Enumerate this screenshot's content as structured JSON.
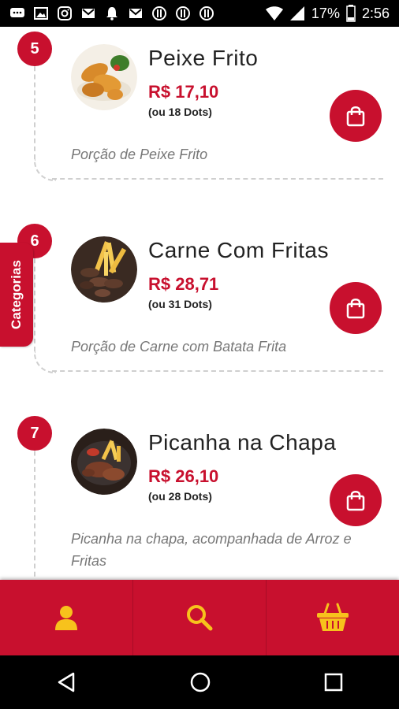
{
  "status_bar": {
    "battery": "17%",
    "time": "2:56"
  },
  "side_tab": {
    "label": "Categorias"
  },
  "products": [
    {
      "number": "5",
      "name": "Peixe Frito",
      "price": "R$ 17,10",
      "dots": "(ou 18 Dots)",
      "description": "Porção de Peixe Frito"
    },
    {
      "number": "6",
      "name": "Carne Com Fritas",
      "price": "R$ 28,71",
      "dots": "(ou 31 Dots)",
      "description": "Porção de Carne com Batata Frita"
    },
    {
      "number": "7",
      "name": "Picanha na Chapa",
      "price": "R$ 26,10",
      "dots": "(ou 28 Dots)",
      "description": "Picanha na chapa, acompanhada de Arroz e Fritas"
    }
  ],
  "icons": {
    "bottom_nav": [
      "user-icon",
      "search-icon",
      "basket-icon"
    ],
    "system_nav": [
      "back-icon",
      "home-icon",
      "recents-icon"
    ]
  },
  "colors": {
    "accent": "#c8102e",
    "icon_yellow": "#f7c21c"
  }
}
